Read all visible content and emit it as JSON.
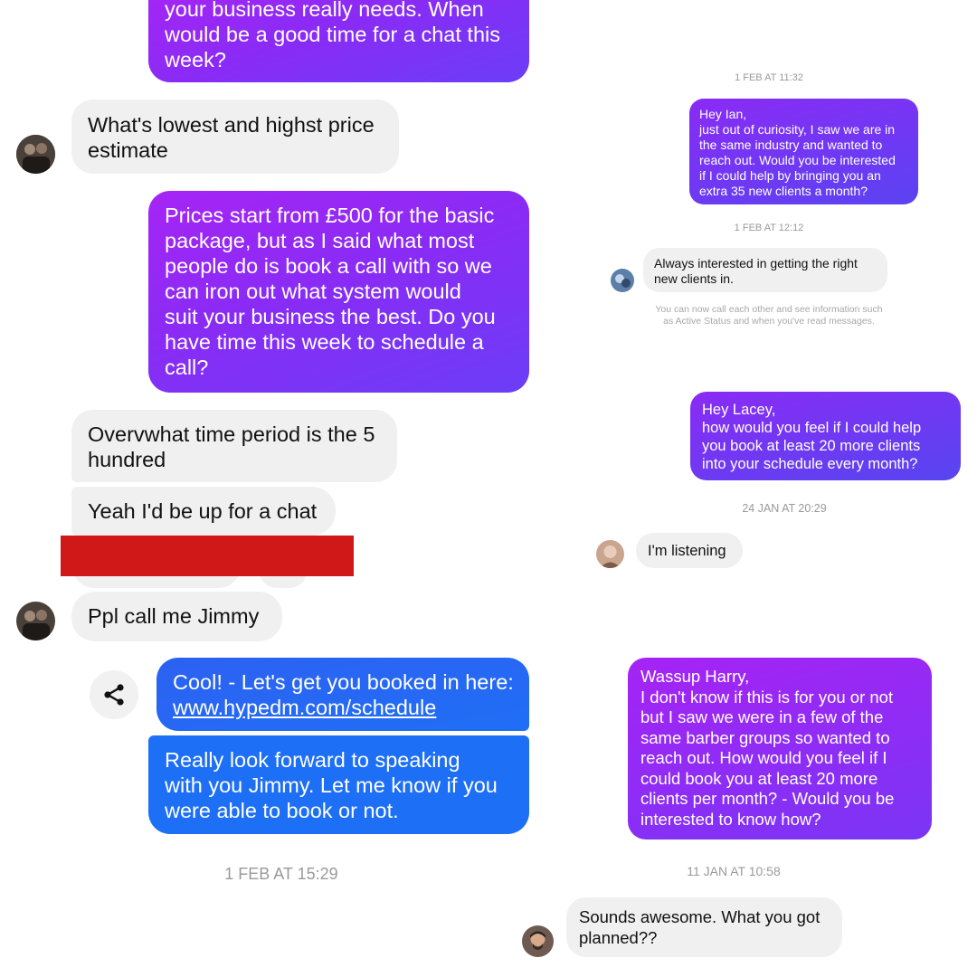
{
  "left": {
    "msg_top_partial": "your business really needs. When\nwould be a good time for a chat this\nweek?",
    "msg_price_question": "What's lowest and highst price\nestimate",
    "msg_prices": "Prices start from £500 for the basic\npackage, but as I said what most\npeople do is book a call with so we\ncan iron out what system would\nsuit your business the best. Do you\nhave time this week to schedule a\ncall?",
    "msg_time_period": "Overvwhat time period is the 5\nhundred",
    "msg_chat": "Yeah I'd be up for a chat",
    "msg_jimmy": "Ppl call me Jimmy",
    "msg_booking_text": "Cool! - Let's get you booked in here:",
    "msg_booking_link": "www.hypedm.com/schedule",
    "msg_forward": "Really look forward to speaking\nwith you Jimmy. Let me know if you\nwere able to book or not.",
    "timestamp_bottom": "1 FEB AT 15:29"
  },
  "right": {
    "ts_1": "1 FEB AT 11:32",
    "msg_ian": "Hey Ian,\njust out of curiosity, I saw we are in\nthe same industry and wanted to\nreach out. Would you be interested\nif I could help by bringing you an\nextra 35 new clients a month?",
    "ts_2": "1 FEB AT 12:12",
    "msg_always": "Always interested in getting the right\nnew clients in.",
    "notice": "You can now call each other and see information such\nas Active Status and when you've read messages.",
    "msg_lacey": "Hey Lacey,\nhow would you feel if I could help\nyou book at least 20 more clients\ninto your schedule every month?",
    "ts_3": "24 JAN AT 20:29",
    "msg_listening": "I'm listening",
    "msg_harry": "Wassup Harry,\nI don't know if this is for you or not\nbut I saw we were in a few of the\nsame barber groups so wanted to\nreach out. How would you feel if I\ncould book you at least 20 more\nclients per month? - Would you be\ninterested to know how?",
    "ts_4": "11 JAN AT 10:58",
    "msg_awesome": "Sounds awesome. What you got\nplanned??"
  },
  "colors": {
    "purple_start": "#a625f5",
    "purple_end": "#6b3df7",
    "blue": "#1f6ff5",
    "received_bg": "#f0f0f0",
    "redaction": "#d11818"
  },
  "icons": {
    "share": "share-icon"
  }
}
